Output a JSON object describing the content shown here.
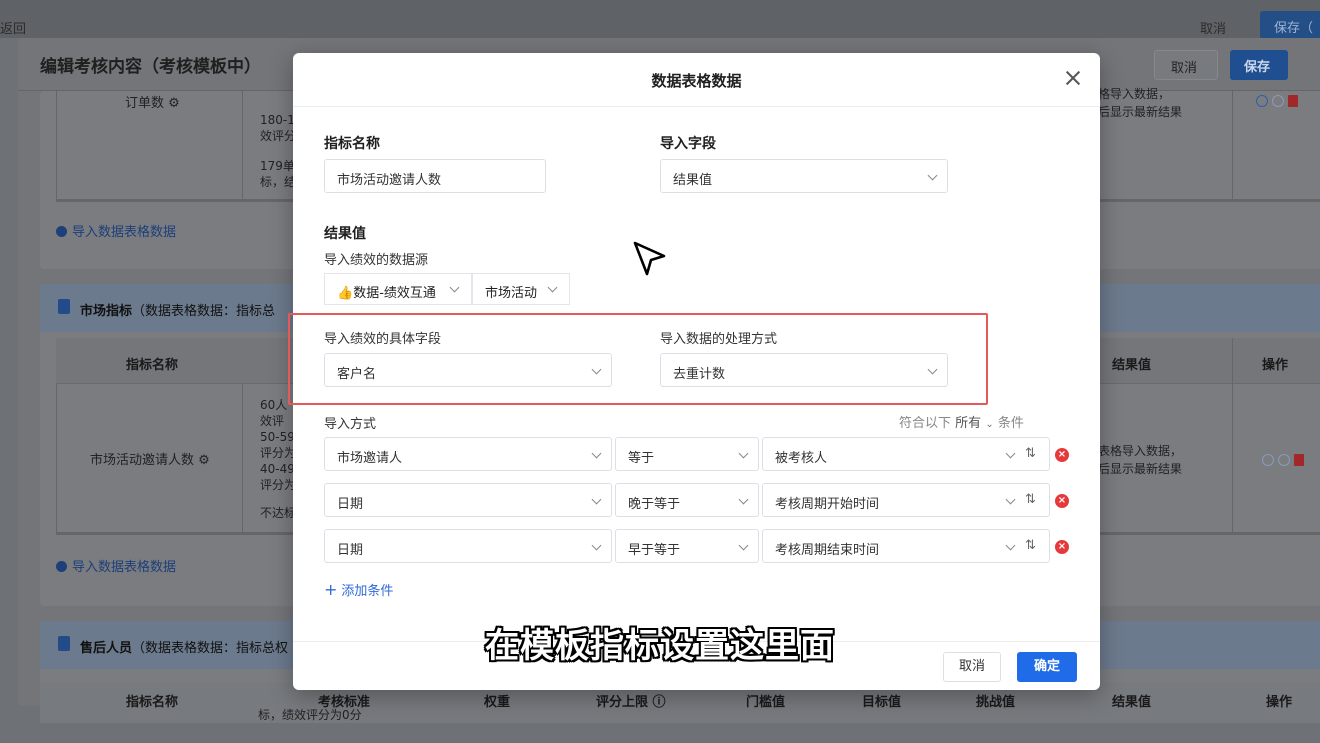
{
  "app": {
    "back_label": "返回",
    "top_cancel": "取消",
    "top_save": "保存（",
    "title": "编辑考核内容（考核模板中）",
    "header_cancel": "取消",
    "header_save": "保存"
  },
  "background": {
    "card1": {
      "metric_name": "订单数",
      "standard_lines": [
        "180-1",
        "效评分",
        "179单",
        "标，结"
      ],
      "result_note_lines": [
        "格导入数据，",
        "后显示最新结果"
      ],
      "import_link": "导入数据表格数据"
    },
    "card2": {
      "title_bold": "市场指标",
      "title_rest": "（数据表格数据：指标总",
      "col_name": "指标名称",
      "col_result": "结果值",
      "col_ops": "操作",
      "metric_name": "市场活动邀请人数",
      "standard_lines": [
        "60人",
        "效评",
        "50-59",
        "评分为",
        "40-49",
        "评分为",
        "不达标"
      ],
      "result_note_lines": [
        "表格导入数据，",
        "后显示最新结果"
      ],
      "import_link": "导入数据表格数据"
    },
    "card3": {
      "title_bold": "售后人员",
      "title_rest": "（数据表格数据：指标总权",
      "columns": [
        "指标名称",
        "考核标准",
        "权重",
        "评分上限 ⓘ",
        "门槛值",
        "目标值",
        "挑战值",
        "结果值",
        "操作"
      ],
      "peek_text": "标，绩效评分为0分"
    }
  },
  "modal": {
    "title": "数据表格数据",
    "metric_name_label": "指标名称",
    "metric_name_value": "市场活动邀请人数",
    "import_field_label": "导入字段",
    "import_field_value": "结果值",
    "result_section_label": "结果值",
    "datasource_label": "导入绩效的数据源",
    "datasource_app": "数据-绩效互通",
    "datasource_app_icon": "👍",
    "datasource_table": "市场活动",
    "specific_field_label": "导入绩效的具体字段",
    "specific_field_value": "客户名",
    "processing_label": "导入数据的处理方式",
    "processing_value": "去重计数",
    "import_method_label": "导入方式",
    "match_prefix": "符合以下",
    "match_mode": "所有",
    "match_suffix": "条件",
    "conditions": [
      {
        "field": "市场邀请人",
        "operator": "等于",
        "value": "被考核人"
      },
      {
        "field": "日期",
        "operator": "晚于等于",
        "value": "考核周期开始时间"
      },
      {
        "field": "日期",
        "operator": "早于等于",
        "value": "考核周期结束时间"
      }
    ],
    "add_condition": "添加条件",
    "cancel": "取消",
    "confirm": "确定"
  },
  "subtitle": "在模板指标设置这里面",
  "colors": {
    "primary": "#1f6be8",
    "highlight_box": "#e45a5a",
    "delete": "#e5393b"
  }
}
